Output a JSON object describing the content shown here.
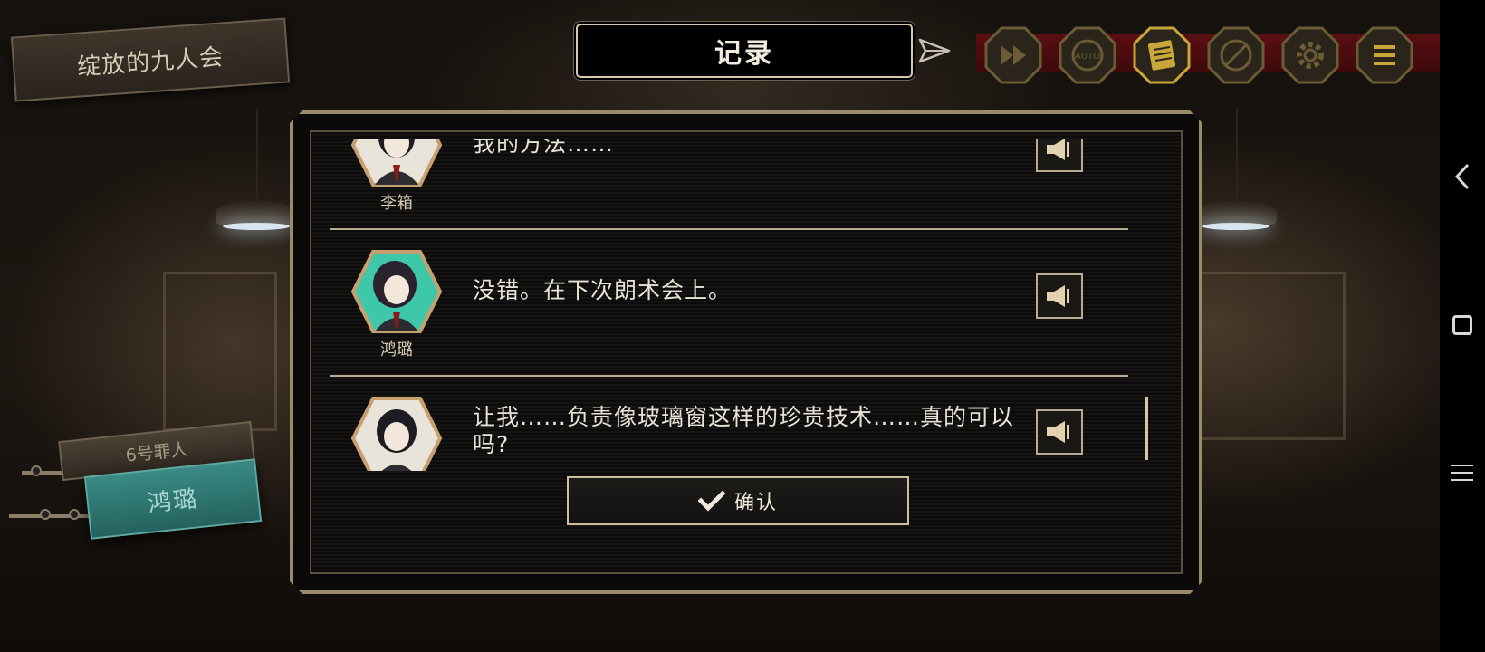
{
  "chapter": {
    "title": "绽放的九人会"
  },
  "header": {
    "title": "记录"
  },
  "toolbar": {
    "buttons": [
      {
        "name": "fast-forward-button",
        "icon": "fast-forward-icon"
      },
      {
        "name": "auto-button",
        "icon": "auto-icon",
        "label": "AUTO"
      },
      {
        "name": "log-button",
        "icon": "log-icon"
      },
      {
        "name": "hide-ui-button",
        "icon": "hide-icon"
      },
      {
        "name": "settings-button",
        "icon": "gear-icon"
      },
      {
        "name": "menu-button",
        "icon": "menu-icon"
      }
    ],
    "colors": {
      "rail": "#5a0f12",
      "frame": "#6b5c36",
      "active": "#c9a63a"
    }
  },
  "log": {
    "entries": [
      {
        "speaker": "李箱",
        "text": "我的方法……",
        "portrait_bg": "#e9e4da"
      },
      {
        "speaker": "鸿璐",
        "text": "没错。在下次朗术会上。",
        "portrait_bg": "#3fc7a9"
      },
      {
        "speaker": "",
        "text": "让我……负责像玻璃窗这样的珍贵技术……真的可以吗?",
        "portrait_bg": "#e9e4da"
      }
    ]
  },
  "confirm": {
    "label": "确认"
  },
  "character_tag": {
    "label": "6号罪人"
  },
  "name_plate": {
    "label": "鸿璐"
  },
  "colors": {
    "panel_border": "#9c8a6c",
    "text": "#e8e2d6",
    "accent_teal": "#3a8a85"
  }
}
